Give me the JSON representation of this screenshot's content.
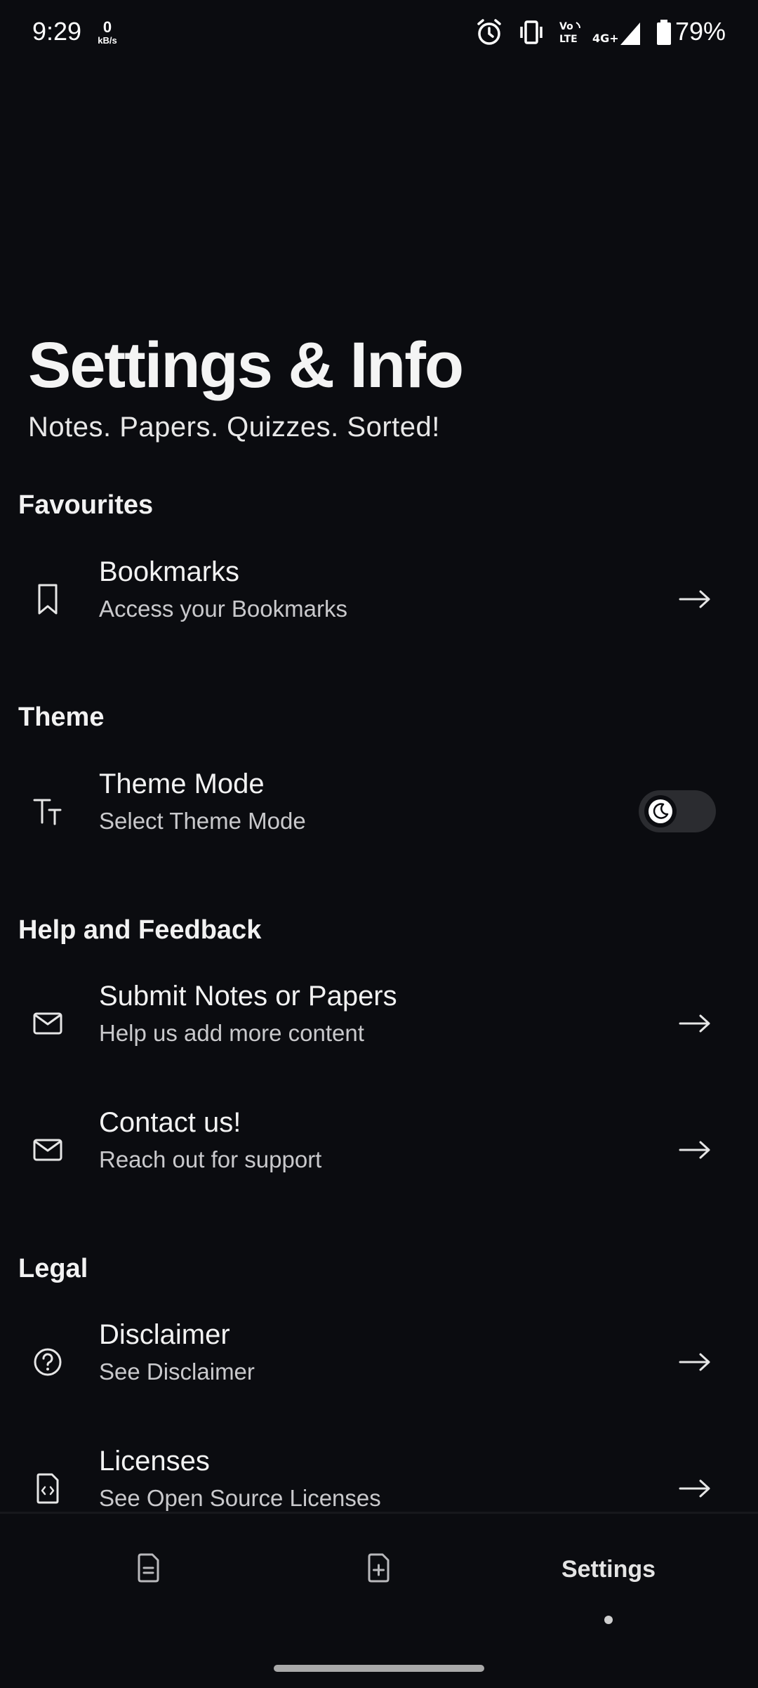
{
  "status_bar": {
    "time": "9:29",
    "net_speed_value": "0",
    "net_speed_unit": "kB/s",
    "battery_percent": "79%",
    "icons": [
      "alarm-icon",
      "vibrate-icon",
      "volte-icon",
      "signal-4g-icon",
      "battery-icon"
    ]
  },
  "header": {
    "title": "Settings & Info",
    "subtitle": "Notes. Papers. Quizzes. Sorted!"
  },
  "sections": {
    "favourites": {
      "label": "Favourites",
      "bookmarks": {
        "title": "Bookmarks",
        "subtitle": "Access your Bookmarks",
        "icon": "bookmark-icon"
      }
    },
    "theme": {
      "label": "Theme",
      "theme_mode": {
        "title": "Theme Mode",
        "subtitle": "Select Theme Mode",
        "icon": "text-size-icon",
        "toggle_state": "dark"
      }
    },
    "help": {
      "label": "Help and Feedback",
      "submit": {
        "title": "Submit Notes or Papers",
        "subtitle": "Help us add more content",
        "icon": "mail-icon"
      },
      "contact": {
        "title": "Contact us!",
        "subtitle": "Reach out for support",
        "icon": "mail-icon"
      }
    },
    "legal": {
      "label": "Legal",
      "disclaimer": {
        "title": "Disclaimer",
        "subtitle": "See Disclaimer",
        "icon": "help-circle-icon"
      },
      "licenses": {
        "title": "Licenses",
        "subtitle": "See Open Source Licenses",
        "icon": "code-file-icon"
      }
    }
  },
  "bottom_nav": {
    "tabs": [
      {
        "icon": "notes-file-icon"
      },
      {
        "icon": "add-file-icon"
      },
      {
        "label": "Settings",
        "active": true
      }
    ]
  },
  "colors": {
    "background": "#0b0c10",
    "text_primary": "#f2f2f2",
    "text_secondary": "#c9c9cc",
    "toggle_track": "#2b2c30"
  }
}
